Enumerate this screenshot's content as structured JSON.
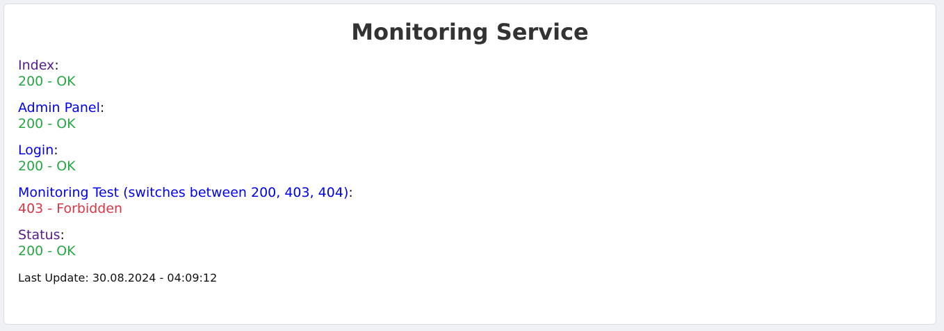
{
  "page": {
    "title": "Monitoring Service"
  },
  "checks": [
    {
      "label": "Index",
      "separator": ":",
      "status": "200 - OK",
      "label_color": "#551a8b",
      "status_color": "#28a745"
    },
    {
      "label": "Admin Panel",
      "separator": ":",
      "status": "200 - OK",
      "label_color": "#0000ee",
      "status_color": "#28a745"
    },
    {
      "label": "Login",
      "separator": ":",
      "status": "200 - OK",
      "label_color": "#0000ee",
      "status_color": "#28a745"
    },
    {
      "label": "Monitoring Test (switches between 200, 403, 404)",
      "separator": ":",
      "status": "403 - Forbidden",
      "label_color": "#0000ee",
      "status_color": "#dc3545"
    },
    {
      "label": "Status",
      "separator": ":",
      "status": "200 - OK",
      "label_color": "#551a8b",
      "status_color": "#28a745"
    }
  ],
  "footer": {
    "last_update": "Last Update: 30.08.2024 - 04:09:12"
  }
}
